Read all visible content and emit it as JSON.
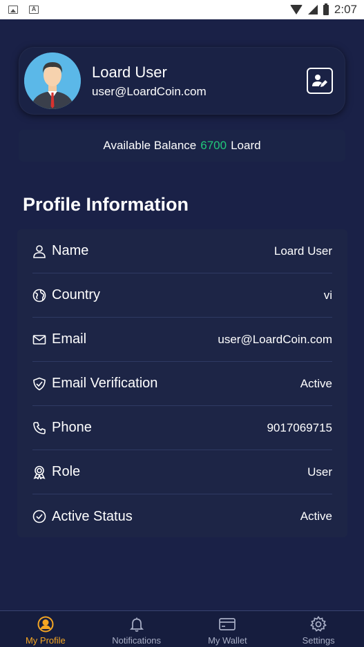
{
  "status_bar": {
    "time": "2:07",
    "left_icons": [
      "image-icon",
      "a-icon"
    ]
  },
  "profile": {
    "name": "Loard User",
    "email": "user@LoardCoin.com"
  },
  "balance": {
    "label": "Available Balance",
    "amount": "6700",
    "currency": "Loard",
    "amount_color": "#21c97a"
  },
  "section_title": "Profile Information",
  "rows": [
    {
      "icon": "user-icon",
      "label": "Name",
      "value": "Loard User"
    },
    {
      "icon": "globe-icon",
      "label": "Country",
      "value": "vi"
    },
    {
      "icon": "mail-icon",
      "label": "Email",
      "value": "user@LoardCoin.com"
    },
    {
      "icon": "shield-check-icon",
      "label": "Email Verification",
      "value": "Active"
    },
    {
      "icon": "phone-icon",
      "label": "Phone",
      "value": "9017069715"
    },
    {
      "icon": "award-icon",
      "label": "Role",
      "value": "User"
    },
    {
      "icon": "check-circle-icon",
      "label": "Active Status",
      "value": "Active"
    }
  ],
  "nav": [
    {
      "icon": "profile-icon",
      "label": "My Profile",
      "active": true
    },
    {
      "icon": "bell-icon",
      "label": "Notifications",
      "active": false
    },
    {
      "icon": "wallet-icon",
      "label": "My Wallet",
      "active": false
    },
    {
      "icon": "gear-icon",
      "label": "Settings",
      "active": false
    }
  ],
  "colors": {
    "background": "#1a2147",
    "accent": "#f5a623",
    "balance_green": "#21c97a"
  }
}
